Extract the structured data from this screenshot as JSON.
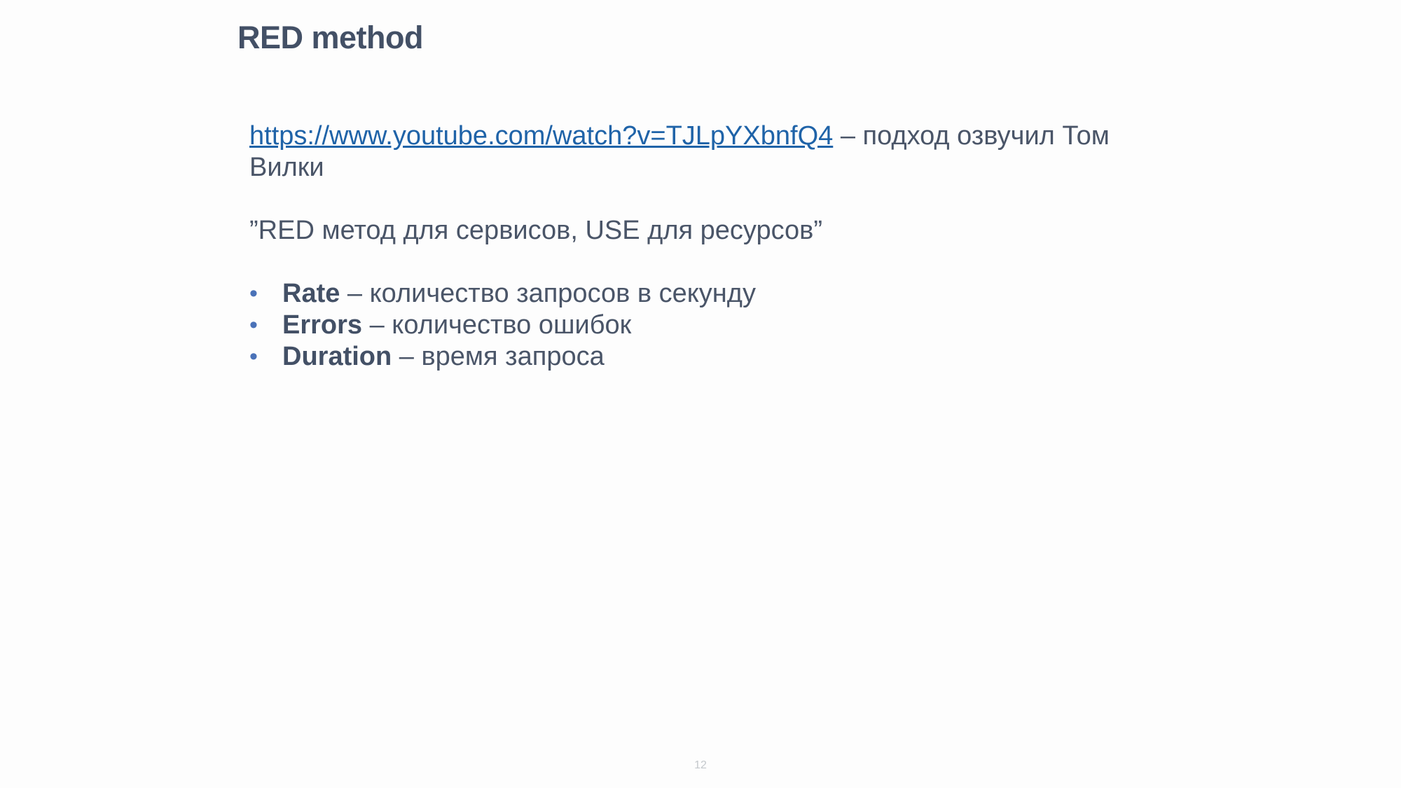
{
  "slide": {
    "title": "RED method",
    "intro": {
      "link_text": "https://www.youtube.com/watch?v=TJLpYXbnfQ4",
      "text_after_link": " – подход озвучил Том Вилки"
    },
    "quote": "”RED метод для сервисов, USE для ресурсов”",
    "bullet_glyph": "•",
    "bullets": [
      {
        "term": "Rate",
        "description": " – количество запросов в секунду"
      },
      {
        "term": "Errors",
        "description": " – количество ошибок"
      },
      {
        "term": "Duration",
        "description": " – время запроса"
      }
    ],
    "page_number": "12"
  },
  "colors": {
    "background": "#fdfdfd",
    "title": "#435066",
    "body_text": "#4a5568",
    "link": "#1f63a8",
    "bullet": "#4a72b8",
    "page_number": "#c4c8cc"
  }
}
